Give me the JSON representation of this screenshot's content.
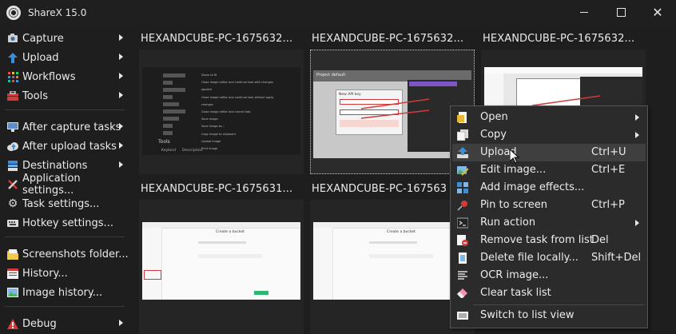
{
  "window": {
    "title": "ShareX 15.0"
  },
  "sidebar": {
    "items": [
      {
        "label": "Capture",
        "icon": "camera-icon",
        "submenu": true
      },
      {
        "label": "Upload",
        "icon": "upload-arrow-icon",
        "submenu": true
      },
      {
        "label": "Workflows",
        "icon": "grid-icon",
        "submenu": true
      },
      {
        "label": "Tools",
        "icon": "toolbox-icon",
        "submenu": true
      },
      {
        "label": "After capture tasks",
        "icon": "monitor-icon",
        "submenu": true
      },
      {
        "label": "After upload tasks",
        "icon": "cloud-icon",
        "submenu": true
      },
      {
        "label": "Destinations",
        "icon": "stack-icon",
        "submenu": true
      },
      {
        "label": "Application settings...",
        "icon": "wrench-icon",
        "submenu": false
      },
      {
        "label": "Task settings...",
        "icon": "gear-icon",
        "submenu": false
      },
      {
        "label": "Hotkey settings...",
        "icon": "keyboard-icon",
        "submenu": false
      },
      {
        "label": "Screenshots folder...",
        "icon": "folder-icon",
        "submenu": false
      },
      {
        "label": "History...",
        "icon": "history-icon",
        "submenu": false
      },
      {
        "label": "Image history...",
        "icon": "image-icon",
        "submenu": false
      },
      {
        "label": "Debug",
        "icon": "warning-icon",
        "submenu": true
      }
    ]
  },
  "tiles": [
    {
      "title": "HEXANDCUBE-PC-1675632..."
    },
    {
      "title": "HEXANDCUBE-PC-1675632..."
    },
    {
      "title": "HEXANDCUBE-PC-1675632..."
    },
    {
      "title": "HEXANDCUBE-PC-1675631..."
    },
    {
      "title": "HEXANDCUBE-PC-167563"
    }
  ],
  "thumb_text": {
    "tools": "Tools",
    "keybind": "Keybind",
    "description": "Description",
    "bucket": "Create a bucket",
    "project": "Project default",
    "new_api_key": "New API key",
    "shortcuts": [
      "Zoom to fit",
      "Close image editor and continue task with changes applied",
      "Close image editor and continue task without apply changes",
      "Close image editor and cancel task",
      "Save image",
      "Save image as...",
      "Copy image to clipboard",
      "Upload image",
      "Print image"
    ]
  },
  "context_menu": {
    "items": [
      {
        "label": "Open",
        "shortcut": "",
        "submenu": true,
        "icon": "open-doc-icon"
      },
      {
        "label": "Copy",
        "shortcut": "",
        "submenu": true,
        "icon": "copy-icon"
      },
      {
        "label": "Upload",
        "shortcut": "Ctrl+U",
        "submenu": false,
        "icon": "upload-icon"
      },
      {
        "label": "Edit image...",
        "shortcut": "Ctrl+E",
        "submenu": false,
        "icon": "edit-image-icon"
      },
      {
        "label": "Add image effects...",
        "shortcut": "",
        "submenu": false,
        "icon": "effects-icon"
      },
      {
        "label": "Pin to screen",
        "shortcut": "Ctrl+P",
        "submenu": false,
        "icon": "pin-icon"
      },
      {
        "label": "Run action",
        "shortcut": "",
        "submenu": true,
        "icon": "terminal-icon"
      },
      {
        "label": "Remove task from list",
        "shortcut": "Del",
        "submenu": false,
        "icon": "remove-task-icon"
      },
      {
        "label": "Delete file locally...",
        "shortcut": "Shift+Del",
        "submenu": false,
        "icon": "delete-file-icon"
      },
      {
        "label": "OCR image...",
        "shortcut": "",
        "submenu": false,
        "icon": "ocr-icon"
      },
      {
        "label": "Clear task list",
        "shortcut": "",
        "submenu": false,
        "icon": "eraser-icon"
      },
      {
        "label": "Switch to list view",
        "shortcut": "",
        "submenu": false,
        "icon": "list-view-icon"
      }
    ]
  },
  "colors": {
    "background": "#1e1e1e",
    "menu": "#2b2b2b",
    "hover": "#3f3f3f",
    "accent_red": "#d23b3b",
    "accent_blue": "#3b8fd9"
  }
}
